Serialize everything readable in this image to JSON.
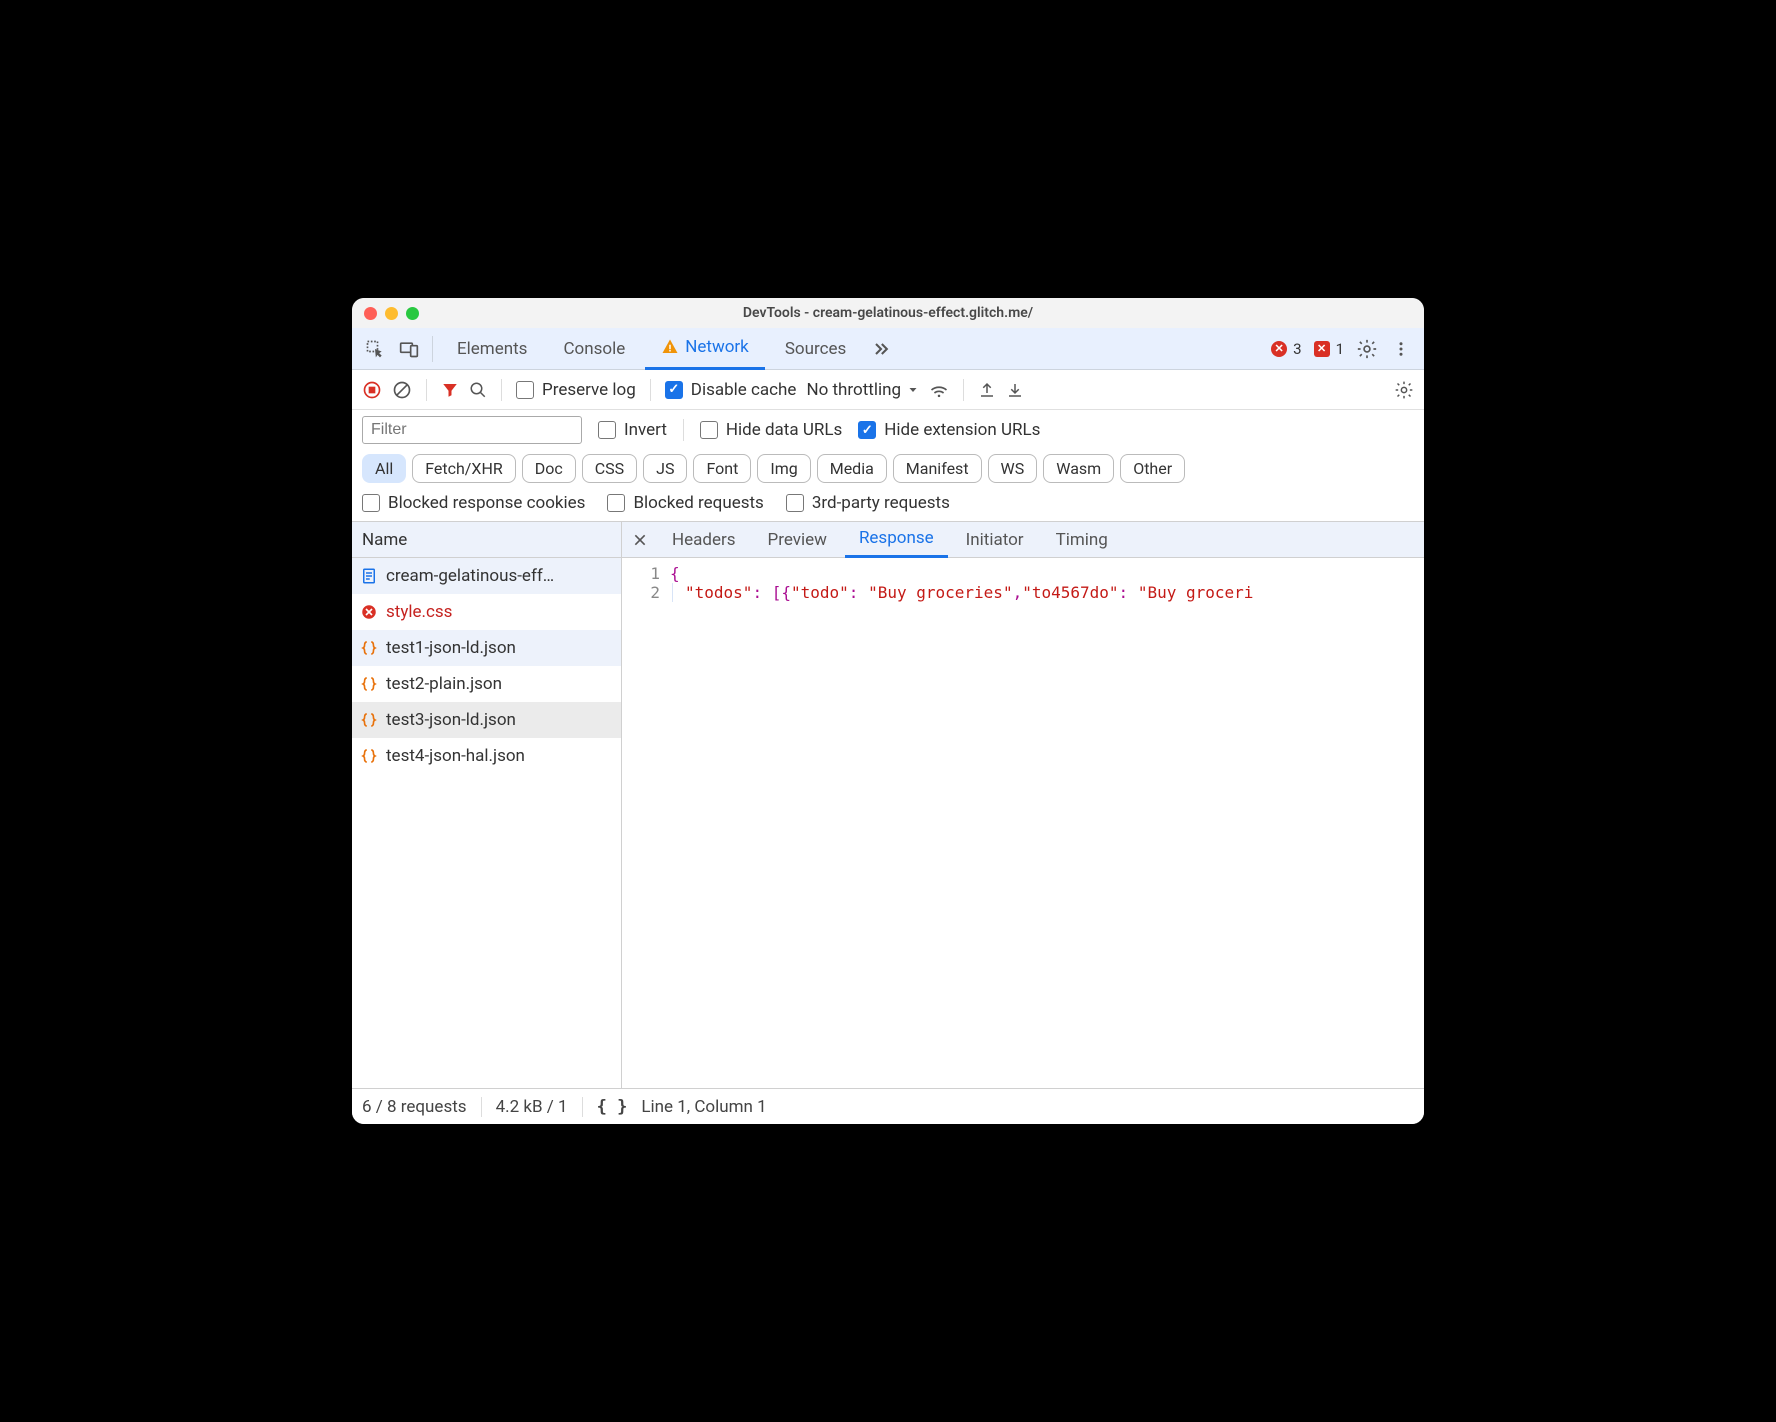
{
  "window": {
    "title": "DevTools - cream-gelatinous-effect.glitch.me/"
  },
  "tabs": {
    "elements": "Elements",
    "console": "Console",
    "network": "Network",
    "sources": "Sources",
    "active": "Network",
    "errors": "3",
    "issues": "1"
  },
  "toolbar": {
    "preserve_log": "Preserve log",
    "disable_cache": "Disable cache",
    "no_throttling": "No throttling"
  },
  "filter": {
    "placeholder": "Filter",
    "invert": "Invert",
    "hide_data": "Hide data URLs",
    "hide_ext": "Hide extension URLs"
  },
  "chips": {
    "all": "All",
    "fetch": "Fetch/XHR",
    "doc": "Doc",
    "css": "CSS",
    "js": "JS",
    "font": "Font",
    "img": "Img",
    "media": "Media",
    "manifest": "Manifest",
    "ws": "WS",
    "wasm": "Wasm",
    "other": "Other"
  },
  "morechecks": {
    "blocked_cookies": "Blocked response cookies",
    "blocked_req": "Blocked requests",
    "third_party": "3rd-party requests"
  },
  "list": {
    "header": "Name",
    "items": [
      {
        "name": "cream-gelatinous-eff…",
        "icon": "document",
        "state": "hl"
      },
      {
        "name": "style.css",
        "icon": "error",
        "state": "err"
      },
      {
        "name": "test1-json-ld.json",
        "icon": "json",
        "state": "hl"
      },
      {
        "name": "test2-plain.json",
        "icon": "json",
        "state": ""
      },
      {
        "name": "test3-json-ld.json",
        "icon": "json",
        "state": "sel"
      },
      {
        "name": "test4-json-hal.json",
        "icon": "json",
        "state": ""
      }
    ]
  },
  "detail": {
    "tabs": {
      "headers": "Headers",
      "preview": "Preview",
      "response": "Response",
      "initiator": "Initiator",
      "timing": "Timing"
    },
    "gutter": [
      "1",
      "2"
    ],
    "response_plain": "{\n  \"todos\": [{\"todo\": \"Buy groceries\",\"to4567do\": \"Buy groceri"
  },
  "status": {
    "requests": "6 / 8 requests",
    "transfer": "4.2 kB / 1",
    "cursor": "Line 1, Column 1"
  }
}
